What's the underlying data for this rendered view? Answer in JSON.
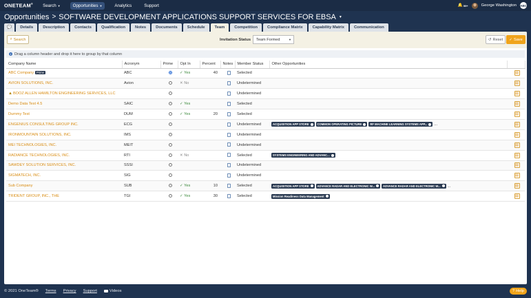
{
  "nav": {
    "logo": "ONETEAM",
    "items": [
      {
        "label": "Search",
        "has_caret": true,
        "active": false
      },
      {
        "label": "Opportunities",
        "has_caret": true,
        "active": true
      },
      {
        "label": "Analytics",
        "has_caret": false,
        "active": false
      },
      {
        "label": "Support",
        "has_caret": false,
        "active": false
      }
    ],
    "notifications": "99+",
    "user_name": "George Washington",
    "user_initials": "ABC"
  },
  "breadcrumb": {
    "root": "Opportunities",
    "separator": ">",
    "title": "SOFTWARE DEVELOPMENT APPLICATIONS SUPPORT SERVICES FOR EBSA"
  },
  "tabs": [
    "Details",
    "Description",
    "Contacts",
    "Qualification",
    "Notes",
    "Documents",
    "Schedule",
    "Team",
    "Competition",
    "Compliance Matrix",
    "Capability Matrix",
    "Communication"
  ],
  "active_tab": "Team",
  "toolbar": {
    "search_label": "Search",
    "invitation_label": "Invitation Status",
    "invitation_value": "Team Formed",
    "reset_label": "Reset",
    "save_label": "Save"
  },
  "group_hint": "Drag a column header and drop it here to group by that column",
  "columns": [
    "Company Name",
    "Acronym",
    "Prime",
    "Opt In",
    "Percent",
    "Notes",
    "Member Status",
    "Other Opportunities"
  ],
  "rows": [
    {
      "name": "ABC Company",
      "prime_badge": "Prime",
      "warn": false,
      "acronym": "ABC",
      "prime": true,
      "optin": "Yes",
      "percent": "40",
      "status": "Selected",
      "opps": [],
      "more": false
    },
    {
      "name": "AVION SOLUTIONS, INC.",
      "prime_badge": "",
      "warn": false,
      "acronym": "Avion",
      "prime": false,
      "optin": "No",
      "percent": "",
      "status": "Undetermined",
      "opps": [],
      "more": false
    },
    {
      "name": "BOOZ ALLEN HAMILTON ENGINEERING SERVICES, LLC",
      "prime_badge": "",
      "warn": true,
      "acronym": "",
      "prime": false,
      "optin": "",
      "percent": "",
      "status": "Undetermined",
      "opps": [],
      "more": false
    },
    {
      "name": "Demo Data Test 4.5",
      "prime_badge": "",
      "warn": false,
      "acronym": "SAIC",
      "prime": false,
      "optin": "Yes",
      "percent": "",
      "status": "Selected",
      "opps": [],
      "more": false
    },
    {
      "name": "Dummy Test",
      "prime_badge": "",
      "warn": false,
      "acronym": "DUM",
      "prime": false,
      "optin": "Yes",
      "percent": "20",
      "status": "Selected",
      "opps": [],
      "more": false
    },
    {
      "name": "ENGENIUS CONSULTING GROUP INC.",
      "prime_badge": "",
      "warn": false,
      "acronym": "ECG",
      "prime": false,
      "optin": "",
      "percent": "",
      "status": "Undetermined",
      "opps": [
        "ACQUISITION APP STORE",
        "COMMON OPERATING PICTURE",
        "RF MACHINE LEARNING SYSTEMS APP..."
      ],
      "more": true
    },
    {
      "name": "IRONMOUNTAIN SOLUTIONS, INC.",
      "prime_badge": "",
      "warn": false,
      "acronym": "IMS",
      "prime": false,
      "optin": "",
      "percent": "",
      "status": "Undetermined",
      "opps": [],
      "more": false
    },
    {
      "name": "MEI TECHNOLOGIES, INC.",
      "prime_badge": "",
      "warn": false,
      "acronym": "MEIT",
      "prime": false,
      "optin": "",
      "percent": "",
      "status": "Undetermined",
      "opps": [],
      "more": false
    },
    {
      "name": "RADIANCE TECHNOLOGIES, INC.",
      "prime_badge": "",
      "warn": false,
      "acronym": "RTI",
      "prime": false,
      "optin": "No",
      "percent": "",
      "status": "Selected",
      "opps": [
        "SYSTEMS ENGINEERING AND ADVANC..."
      ],
      "more": false
    },
    {
      "name": "SAWDEY SOLUTION SERVICES, INC.",
      "prime_badge": "",
      "warn": false,
      "acronym": "SSSI",
      "prime": false,
      "optin": "",
      "percent": "",
      "status": "Undetermined",
      "opps": [],
      "more": false
    },
    {
      "name": "SIGMATECH, INC.",
      "prime_badge": "",
      "warn": false,
      "acronym": "SIG",
      "prime": false,
      "optin": "",
      "percent": "",
      "status": "Undetermined",
      "opps": [],
      "more": false
    },
    {
      "name": "Sub Company",
      "prime_badge": "",
      "warn": false,
      "acronym": "SUB",
      "prime": false,
      "optin": "Yes",
      "percent": "10",
      "status": "Selected",
      "opps": [
        "ACQUISITION APP STORE",
        "ADVANCE RADAR AND ELECTRONIC W...",
        "ADVANCE RADAR AND ELECTRONIC W..."
      ],
      "more": true
    },
    {
      "name": "TRIDENT GROUP, INC., THE",
      "prime_badge": "",
      "warn": false,
      "acronym": "TGI",
      "prime": false,
      "optin": "Yes",
      "percent": "30",
      "status": "Selected",
      "opps": [
        "Mission Readiness Data Management"
      ],
      "more": false
    }
  ],
  "footer": {
    "copyright": "© 2021 OneTeam®",
    "links": [
      "Terms",
      "Privacy",
      "Support"
    ],
    "videos_label": "Videos",
    "help_label": "Help"
  }
}
